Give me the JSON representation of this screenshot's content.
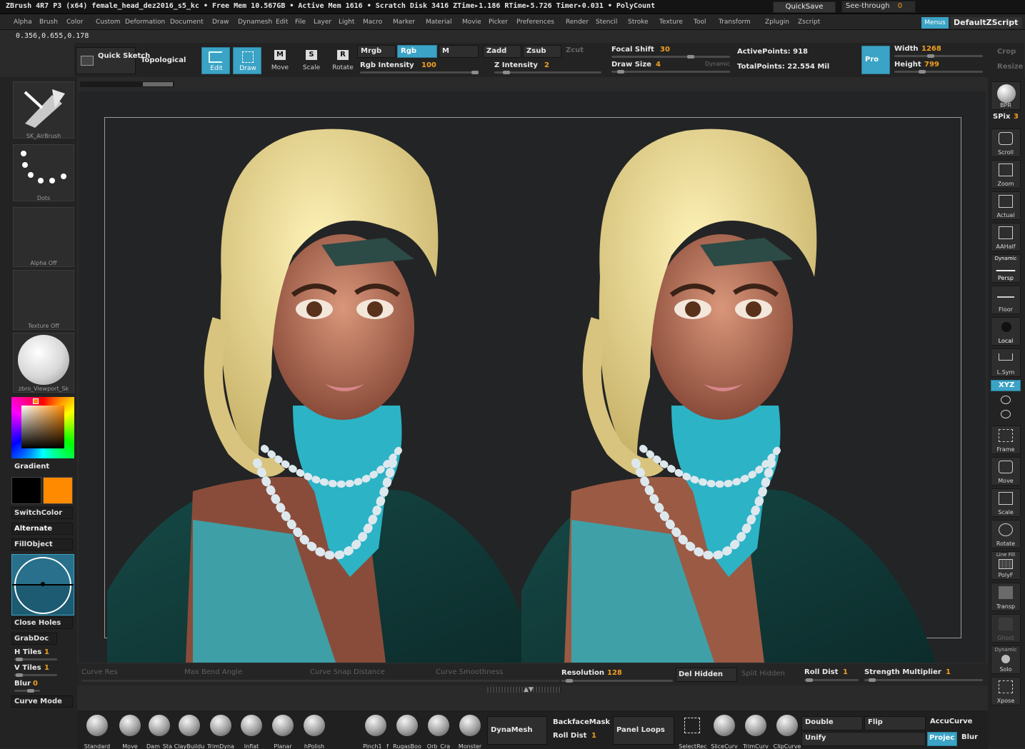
{
  "titlebar": {
    "text": "ZBrush 4R7 P3 (x64)    female_head_dez2016_s5_kc    • Free Mem 10.567GB • Active Mem 1616 • Scratch Disk 3416   ZTime▸1.186 RTime▸5.726 Timer▸0.031 • PolyCount",
    "quicksave": "QuickSave",
    "see_through_label": "See-through",
    "see_through_value": "0",
    "menus_toggle": "Menus",
    "default_script": "DefaultZScript"
  },
  "menu": [
    "Alpha",
    "Brush",
    "Color",
    "Custom",
    "Deformation",
    "Document",
    "Draw",
    "Dynamesh",
    "Edit",
    "File",
    "Layer",
    "Light",
    "Macro",
    "Marker",
    "Material",
    "Movie",
    "Picker",
    "Preferences",
    "Render",
    "Stencil",
    "Stroke",
    "Texture",
    "Tool",
    "Transform",
    "Zplugin",
    "Zscript"
  ],
  "coords": "0.356,0.655,0.178",
  "top_toolbar": {
    "quick_sketch": "Quick Sketch",
    "topological": "Topological",
    "edit": "Edit",
    "draw": "Draw",
    "move": "Move",
    "scale": "Scale",
    "rotate": "Rotate",
    "mrgb": "Mrgb",
    "rgb": "Rgb",
    "m": "M",
    "zadd": "Zadd",
    "zsub": "Zsub",
    "zcut": "Zcut",
    "rgb_intensity_label": "Rgb Intensity",
    "rgb_intensity_value": "100",
    "z_intensity_label": "Z Intensity",
    "z_intensity_value": "2",
    "focal_shift_label": "Focal Shift",
    "focal_shift_value": "30",
    "draw_size_label": "Draw Size",
    "draw_size_value": "4",
    "dynamic": "Dynamic",
    "active_points_label": "ActivePoints:",
    "active_points_value": "918",
    "total_points_label": "TotalPoints:",
    "total_points_value": "22.554 Mil",
    "pro": "Pro",
    "width_label": "Width",
    "width_value": "1268",
    "height_label": "Height",
    "height_value": "799",
    "crop": "Crop",
    "resize": "Resize"
  },
  "left_panel": {
    "brush_name": "SK_AirBrush",
    "stroke_name": "Dots",
    "alpha_label": "Alpha Off",
    "texture_label": "Texture Off",
    "material_name": "zbro_Viewport_Sk",
    "gradient": "Gradient",
    "switch_color": "SwitchColor",
    "alternate": "Alternate",
    "fill_object": "FillObject",
    "close_holes": "Close Holes",
    "grab_doc": "GrabDoc",
    "h_tiles_label": "H Tiles",
    "h_tiles_value": "1",
    "v_tiles_label": "V Tiles",
    "v_tiles_value": "1",
    "blur_label": "Blur",
    "blur_value": "0",
    "curve_mode": "Curve Mode",
    "primary_color": "#000000",
    "secondary_color": "#ff8a00"
  },
  "right_panel": {
    "bpr": "BPR",
    "spix_label": "SPix",
    "spix_value": "3",
    "scroll": "Scroll",
    "zoom": "Zoom",
    "actual": "Actual",
    "aahalf": "AAHalf",
    "dynamic_persp": "Dynamic",
    "persp": "Persp",
    "floor": "Floor",
    "local": "Local",
    "lsym": "L.Sym",
    "xyz": "XYZ",
    "frame": "Frame",
    "move": "Move",
    "scale": "Scale",
    "rotate": "Rotate",
    "line_fill": "Line Fill",
    "polyf": "PolyF",
    "transp": "Transp",
    "ghost": "Ghost",
    "dynamic_solo": "Dynamic",
    "solo": "Solo",
    "xpose": "Xpose"
  },
  "bottom_bar": {
    "curve_res": "Curve Res",
    "max_bend_angle": "Max Bend Angle",
    "curve_snap_distance": "Curve Snap Distance",
    "curve_smoothness": "Curve Smoothness",
    "resolution_label": "Resolution",
    "resolution_value": "128",
    "del_hidden": "Del Hidden",
    "split_hidden": "Split Hidden",
    "roll_dist_label": "Roll Dist",
    "roll_dist_value": "1",
    "strength_multiplier_label": "Strength Multiplier",
    "strength_multiplier_value": "1"
  },
  "shelf": {
    "brushes": [
      "Standard",
      "Move",
      "Dam_Sta",
      "ClayBuildu",
      "TrimDyna",
      "Inflat",
      "Planar",
      "hPolish"
    ],
    "brushes2": [
      "Pinch1 _f",
      "RugasBoo",
      "Orb_Cra",
      "Monster"
    ],
    "dynamesh": "DynaMesh",
    "backface_mask": "BackfaceMask",
    "roll_dist_label": "Roll Dist",
    "roll_dist_value": "1",
    "panel_loops": "Panel Loops",
    "select_rect": "SelectRec",
    "slice_curve": "SliceCurv",
    "trim_curve": "TrimCurv",
    "clip_curve": "ClipCurve",
    "double": "Double",
    "flip": "Flip",
    "accucurve": "AccuCurve",
    "unify": "Unify",
    "project": "Projec",
    "blur": "Blur"
  }
}
